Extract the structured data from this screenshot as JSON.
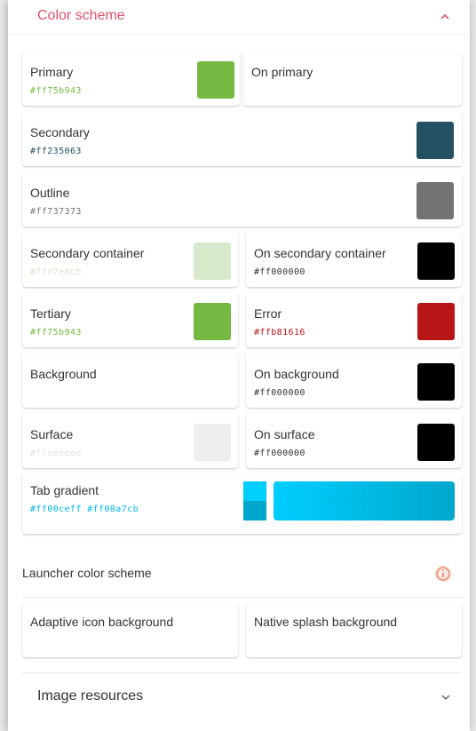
{
  "color_scheme": {
    "title": "Color scheme",
    "expanded_icon": "chevron-up-icon",
    "accent_color": "#d9536b",
    "items": {
      "primary": {
        "label": "Primary",
        "value": "#ff75b943",
        "swatch": "#75b943",
        "value_color": "#75b943"
      },
      "on_primary": {
        "label": "On primary"
      },
      "secondary": {
        "label": "Secondary",
        "value": "#ff235063",
        "swatch": "#235063",
        "value_color": "#235063"
      },
      "outline": {
        "label": "Outline",
        "value": "#ff737373",
        "swatch": "#737373",
        "value_color": "#737373"
      },
      "secondary_container": {
        "label": "Secondary container",
        "value": "#ffd7e8cb",
        "swatch": "#d7e8cb",
        "value_color": "#d7e8cb"
      },
      "on_secondary_container": {
        "label": "On secondary container",
        "value": "#ff000000",
        "swatch": "#000000",
        "value_color": "#333333"
      },
      "tertiary": {
        "label": "Tertiary",
        "value": "#ff75b943",
        "swatch": "#75b943",
        "value_color": "#75b943"
      },
      "error": {
        "label": "Error",
        "value": "#ffb81616",
        "swatch": "#b81616",
        "value_color": "#b81616"
      },
      "background": {
        "label": "Background"
      },
      "on_background": {
        "label": "On background",
        "value": "#ff000000",
        "swatch": "#000000",
        "value_color": "#333333"
      },
      "surface": {
        "label": "Surface",
        "value": "#ffeeeeee",
        "swatch": "#eeeeee",
        "value_color": "#e2e2e2"
      },
      "on_surface": {
        "label": "On surface",
        "value": "#ff000000",
        "swatch": "#000000",
        "value_color": "#333333"
      },
      "tab_gradient": {
        "label": "Tab gradient",
        "value": "#ff00ceff #ff00a7cb",
        "value_color": "#00b6e6",
        "start": "#00ceff",
        "end": "#00a7cb"
      }
    }
  },
  "launcher": {
    "title": "Launcher color scheme",
    "info_icon": "info-icon",
    "info_color": "#e8775a",
    "adaptive_icon_background": "Adaptive icon background",
    "native_splash_background": "Native splash background"
  },
  "image_resources": {
    "title": "Image resources",
    "collapsed_icon": "chevron-down-icon"
  }
}
